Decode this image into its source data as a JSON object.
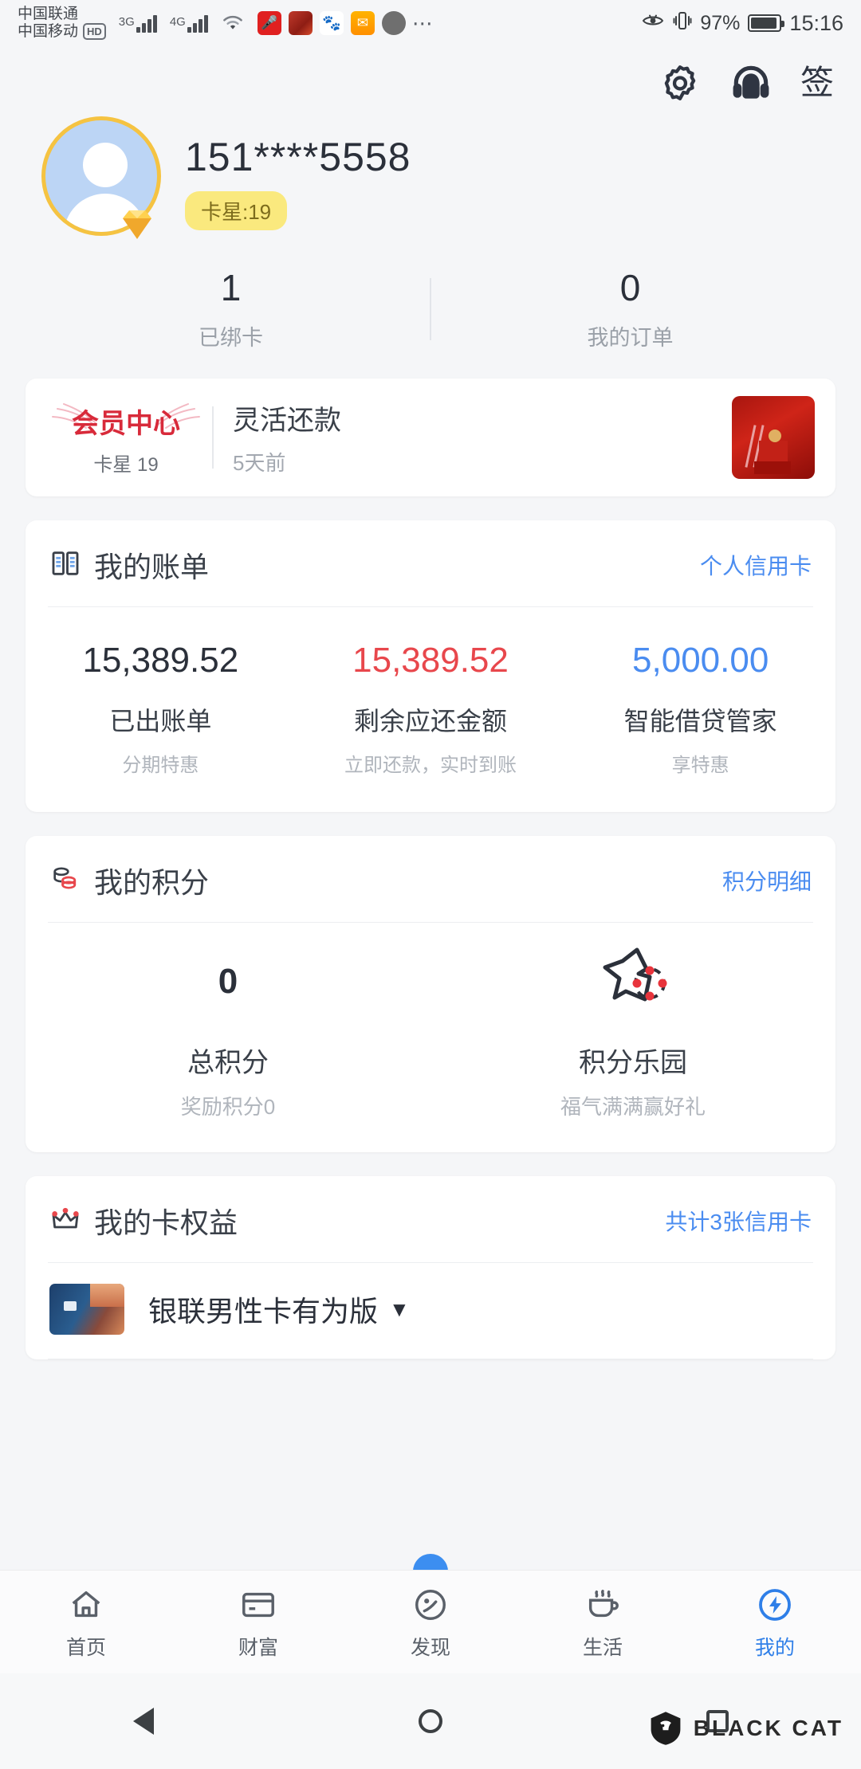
{
  "status_bar": {
    "carrier_1": "中国联通",
    "carrier_2": "中国移动",
    "hd_label": "HD",
    "net_1": "3G",
    "net_2": "4G",
    "net_2_sup": "+",
    "battery_percent": "97%",
    "time": "15:16",
    "icons": [
      "wifi-icon",
      "microphone-icon",
      "festival-app-icon",
      "baidu-icon",
      "mail-icon",
      "chat-icon",
      "more-dots-icon",
      "eye-comfort-icon",
      "vibrate-icon",
      "battery-icon"
    ]
  },
  "header": {
    "settings_icon": "gear-icon",
    "service_icon": "headset-icon",
    "sign_label": "签"
  },
  "profile": {
    "phone_masked": "151****5558",
    "star_badge": "卡星:19",
    "avatar_icon": "person-avatar",
    "gem_icon": "diamond-badge-icon"
  },
  "stats": [
    {
      "value": "1",
      "label": "已绑卡"
    },
    {
      "value": "0",
      "label": "我的订单"
    }
  ],
  "member_card": {
    "logo_title": "会员中心",
    "logo_sub": "卡星 19",
    "title": "灵活还款",
    "time_ago": "5天前",
    "thumb_icon": "promo-red-thumbnail"
  },
  "bill": {
    "icon": "ledger-book-icon",
    "title": "我的账单",
    "link": "个人信用卡",
    "columns": [
      {
        "amount": "15,389.52",
        "name": "已出账单",
        "desc": "分期特惠",
        "color": "#2b303a"
      },
      {
        "amount": "15,389.52",
        "name": "剩余应还金额",
        "desc": "立即还款，实时到账",
        "color": "#e8474c"
      },
      {
        "amount": "5,000.00",
        "name": "智能借贷管家",
        "desc": "享特惠",
        "color": "#4a8cf0"
      }
    ]
  },
  "points": {
    "icon": "coin-stack-icon",
    "title": "我的积分",
    "link": "积分明细",
    "total_value": "0",
    "total_label": "总积分",
    "total_desc": "奖励积分0",
    "park_icon": "star-dots-icon",
    "park_label": "积分乐园",
    "park_desc": "福气满满赢好礼"
  },
  "card_rights": {
    "icon": "crown-icon",
    "title": "我的卡权益",
    "link": "共计3张信用卡",
    "card_name": "银联男性卡有为版",
    "caret": "▼",
    "card_thumb_icon": "credit-card-thumbnail"
  },
  "tabbar": [
    {
      "icon": "home-icon",
      "label": "首页",
      "active": false
    },
    {
      "icon": "wallet-card-icon",
      "label": "财富",
      "active": false
    },
    {
      "icon": "compass-icon",
      "label": "发现",
      "active": false
    },
    {
      "icon": "coffee-cup-icon",
      "label": "生活",
      "active": false
    },
    {
      "icon": "profile-lightning-icon",
      "label": "我的",
      "active": true
    }
  ],
  "system_nav": [
    "back-triangle-icon",
    "home-circle-icon",
    "recents-square-icon"
  ],
  "watermark": {
    "text": "BLACK CAT",
    "icon": "black-cat-logo"
  },
  "colors": {
    "accent_blue": "#4a8cf0",
    "alert_red": "#e8474c",
    "badge_yellow": "#fae97e",
    "avatar_ring": "#f5c342"
  }
}
